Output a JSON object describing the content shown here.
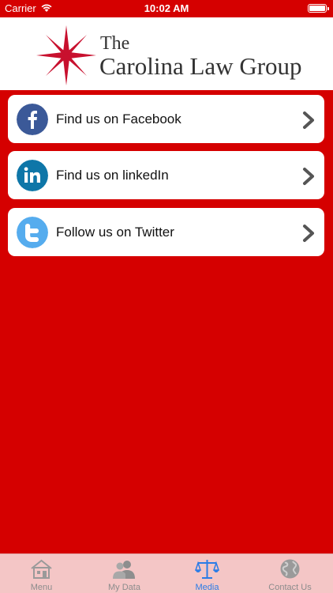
{
  "status_bar": {
    "carrier": "Carrier",
    "time": "10:02 AM",
    "wifi_icon": "wifi-icon",
    "battery_icon": "battery-icon"
  },
  "header": {
    "logo_the": "The",
    "logo_name": "Carolina Law Group",
    "logo_icon": "compass-rose-logo-icon"
  },
  "social_links": [
    {
      "label": "Find us on Facebook",
      "icon": "facebook-icon",
      "color": "#3b5998"
    },
    {
      "label": "Find us on linkedIn",
      "icon": "linkedin-icon",
      "color": "#0e76a8"
    },
    {
      "label": "Follow us on Twitter",
      "icon": "twitter-icon",
      "color": "#55acee"
    }
  ],
  "tabs": [
    {
      "label": "Menu",
      "icon": "home-icon",
      "active": false
    },
    {
      "label": "My Data",
      "icon": "users-icon",
      "active": false
    },
    {
      "label": "Media",
      "icon": "scales-icon",
      "active": true
    },
    {
      "label": "Contact Us",
      "icon": "globe-icon",
      "active": false
    }
  ],
  "colors": {
    "background": "#d50000",
    "tab_bar": "#f4c6c6",
    "tab_active": "#2b7ce6",
    "tab_inactive": "#8c8c8c",
    "logo_red": "#c8102e"
  }
}
